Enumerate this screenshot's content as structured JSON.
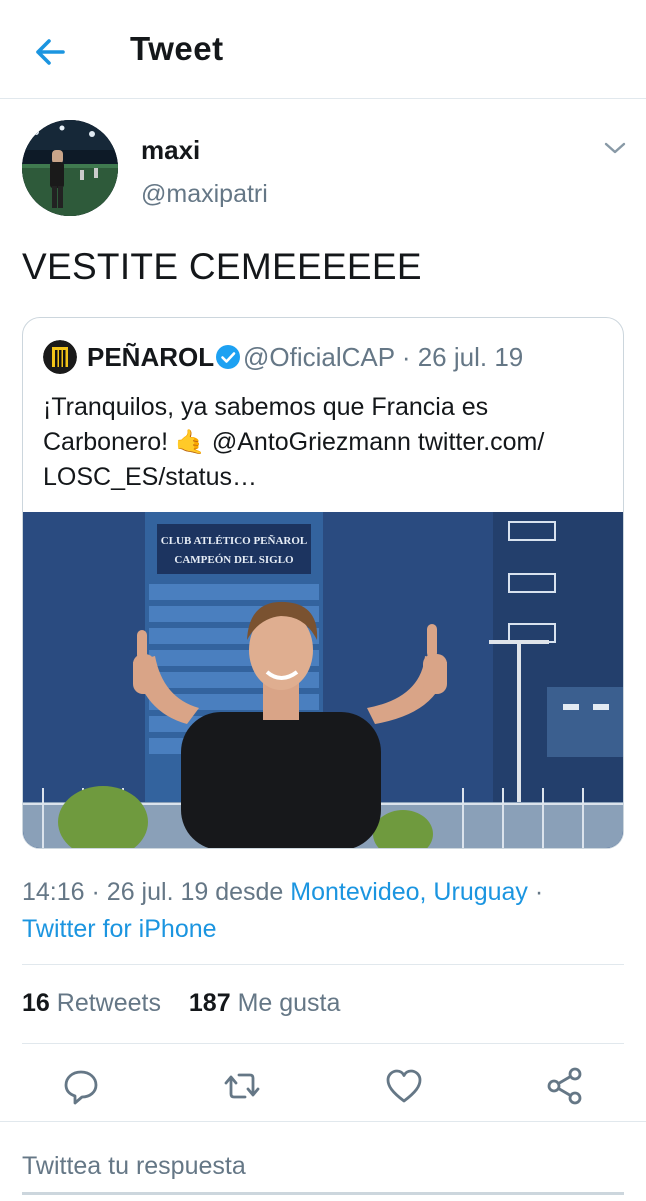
{
  "header": {
    "title": "Tweet"
  },
  "tweet": {
    "author_name": "maxi",
    "author_handle": "@maxipatri",
    "text": "VESTITE CEMEEEEEE",
    "time": "14:16",
    "date": "26 jul. 19",
    "from_word": "desde",
    "location": "Montevideo, Uruguay",
    "separator": "·",
    "source": "Twitter for iPhone"
  },
  "quoted": {
    "name": "PEÑAROL",
    "handle_date": "@OficialCAP · 26 jul. 19",
    "line1": "¡Tranquilos, ya sabemos que Francia es",
    "line2_a": "Carbonero!",
    "line2_emoji": "🤙",
    "line2_b": "@AntoGriezmann twitter.com/",
    "line3": "LOSC_ES/status…",
    "media_sign1": "CLUB ATLÉTICO PEÑAROL",
    "media_sign2": "CAMPEÓN DEL SIGLO"
  },
  "stats": {
    "retweets_count": "16",
    "retweets_label": "Retweets",
    "likes_count": "187",
    "likes_label": "Me gusta"
  },
  "reply": {
    "placeholder": "Twittea tu respuesta"
  },
  "colors": {
    "accent": "#1b95e0",
    "secondary_text": "#657786",
    "divider": "#e1e8ed"
  },
  "icons": [
    "back-arrow-icon",
    "chevron-down-icon",
    "verified-icon",
    "reply-icon",
    "retweet-icon",
    "like-icon",
    "share-icon"
  ]
}
